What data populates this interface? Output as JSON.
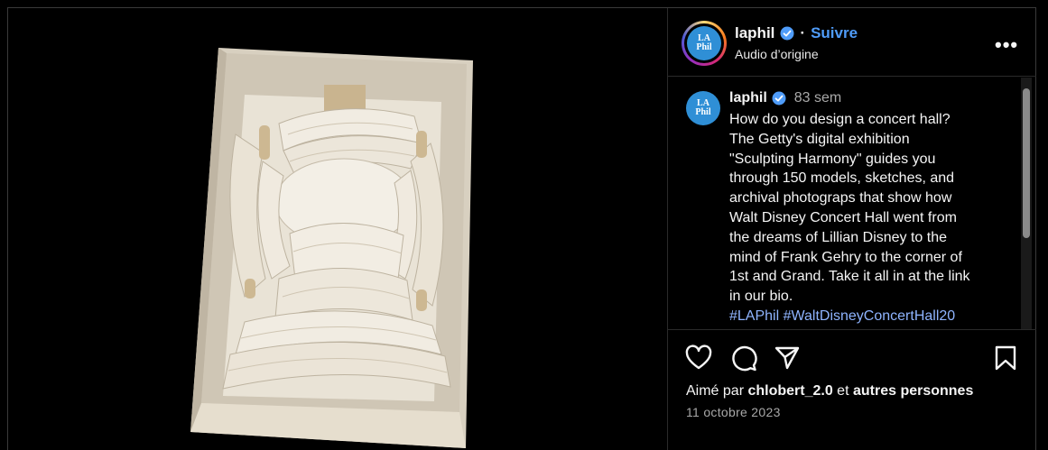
{
  "post": {
    "image_alt": "Architectural model of a concert hall seen from above"
  },
  "header": {
    "avatar_text_top": "LA",
    "avatar_text_bottom": "Phil",
    "username": "laphil",
    "separator": "·",
    "follow_label": "Suivre",
    "audio_label": "Audio d’origine",
    "more_label": "•••"
  },
  "caption": {
    "username": "laphil",
    "time": "83 sem",
    "text": "How do you design a concert hall?\nThe Getty's digital exhibition\n\"Sculpting Harmony\" guides you\nthrough 150 models, sketches, and\narchival photograps that show how\nWalt Disney Concert Hall went from\nthe dreams of Lillian Disney to the\nmind of Frank Gehry to the corner of\n1st and Grand. Take it all in at the link\nin our bio.",
    "hashtags": "#LAPhil #WaltDisneyConcertHall20"
  },
  "actions": {
    "like_icon": "heart-icon",
    "comment_icon": "comment-icon",
    "share_icon": "send-icon",
    "save_icon": "bookmark-icon"
  },
  "likes": {
    "prefix": "Aimé par ",
    "user": "chlobert_2.0",
    "middle": " et ",
    "others": "autres personnes"
  },
  "date": "11 octobre 2023",
  "colors": {
    "background": "#000000",
    "accent": "#4f9cf9",
    "hashtag": "#8fb4ff",
    "avatar": "#2f8fd6"
  }
}
